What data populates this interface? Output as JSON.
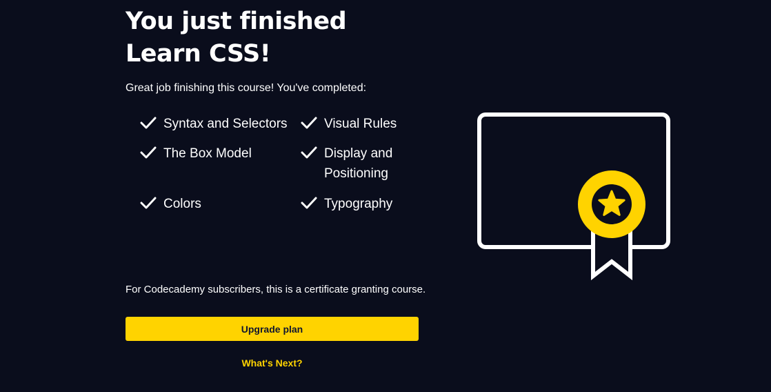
{
  "header": {
    "title_line1": "You just finished",
    "title_line2": "Learn CSS!"
  },
  "intro_text": "Great job finishing this course! You've completed:",
  "lessons": [
    {
      "label": "Syntax and Selectors",
      "icon": "check-icon"
    },
    {
      "label": "Visual Rules",
      "icon": "check-icon"
    },
    {
      "label": "The Box Model",
      "icon": "check-icon"
    },
    {
      "label": "Display and Positioning",
      "icon": "check-icon"
    },
    {
      "label": "Colors",
      "icon": "check-icon"
    },
    {
      "label": "Typography",
      "icon": "check-icon"
    }
  ],
  "subscriber_note": "For Codecademy subscribers, this is a certificate granting course.",
  "actions": {
    "upgrade_label": "Upgrade plan",
    "whats_next_label": "What's Next?"
  },
  "illustration": {
    "icon": "certificate-icon",
    "badge_icon": "star-badge-icon"
  },
  "colors": {
    "background": "#0a0d1c",
    "accent": "#ffd300",
    "text": "#ffffff",
    "button_text": "#10162f"
  }
}
